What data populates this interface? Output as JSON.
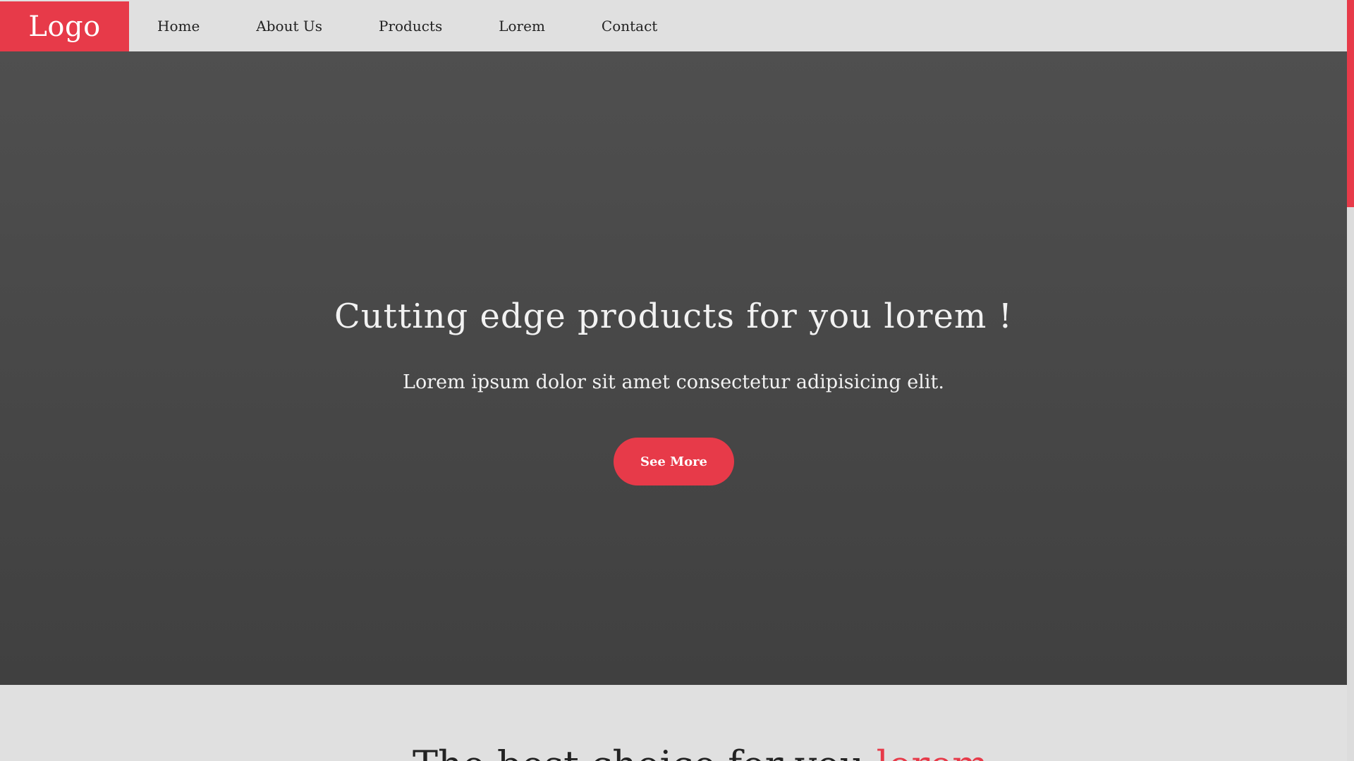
{
  "nav": {
    "logo": "Logo",
    "links": [
      "Home",
      "About Us",
      "Products",
      "Lorem",
      "Contact"
    ]
  },
  "hero": {
    "title": "Cutting edge products for you lorem !",
    "subtitle": "Lorem ipsum dolor sit amet consectetur adipisicing elit.",
    "cta_label": "See More"
  },
  "section_two": {
    "heading_start": "The best choice for you",
    "heading_accent": "lorem"
  },
  "colors": {
    "accent": "#e73a49",
    "navbar_bg": "#e0e0e0",
    "hero_bg": "#4a4a4a"
  }
}
